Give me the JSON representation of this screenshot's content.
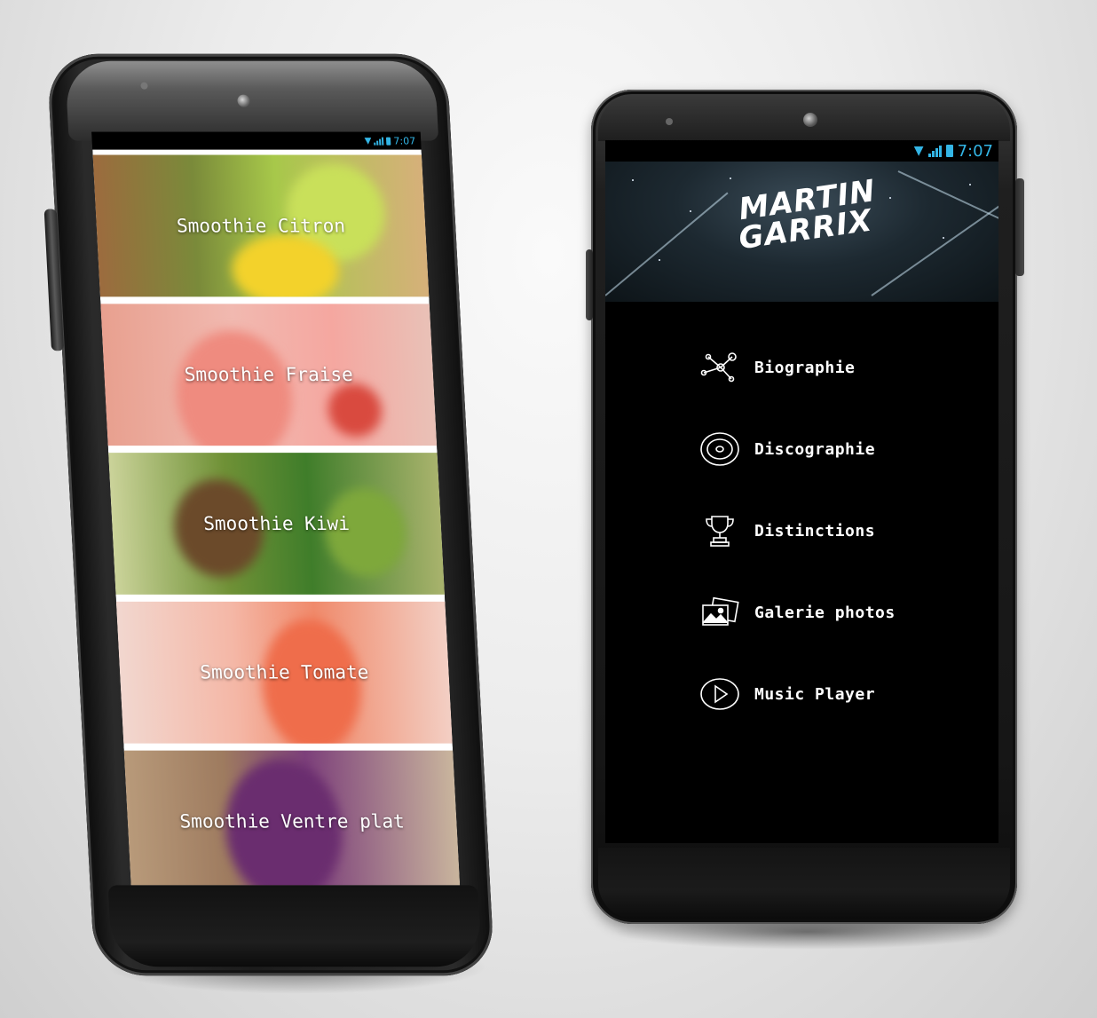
{
  "left_phone": {
    "status": {
      "time": "7:07"
    },
    "tiles": [
      {
        "label": "Smoothie Citron"
      },
      {
        "label": "Smoothie Fraise"
      },
      {
        "label": "Smoothie Kiwi"
      },
      {
        "label": "Smoothie Tomate"
      },
      {
        "label": "Smoothie Ventre plat"
      }
    ]
  },
  "right_phone": {
    "status": {
      "time": "7:07"
    },
    "banner": {
      "logo_line1": "MARTIN",
      "logo_line2": "GARRIX"
    },
    "menu": [
      {
        "label": "Biographie",
        "icon": "network-icon"
      },
      {
        "label": "Discographie",
        "icon": "vinyl-disc-icon"
      },
      {
        "label": "Distinctions",
        "icon": "trophy-icon"
      },
      {
        "label": "Galerie photos",
        "icon": "photos-icon"
      },
      {
        "label": "Music Player",
        "icon": "play-icon"
      }
    ]
  },
  "colors": {
    "status_accent": "#33b5e5",
    "menu_text": "#ffffff",
    "screen_bg": "#000000",
    "citron": "#c9d24a",
    "fraise": "#e98a86",
    "kiwi": "#6e8f2e",
    "tomate": "#f09a8a",
    "ventre_plat": "#7a3e78"
  }
}
